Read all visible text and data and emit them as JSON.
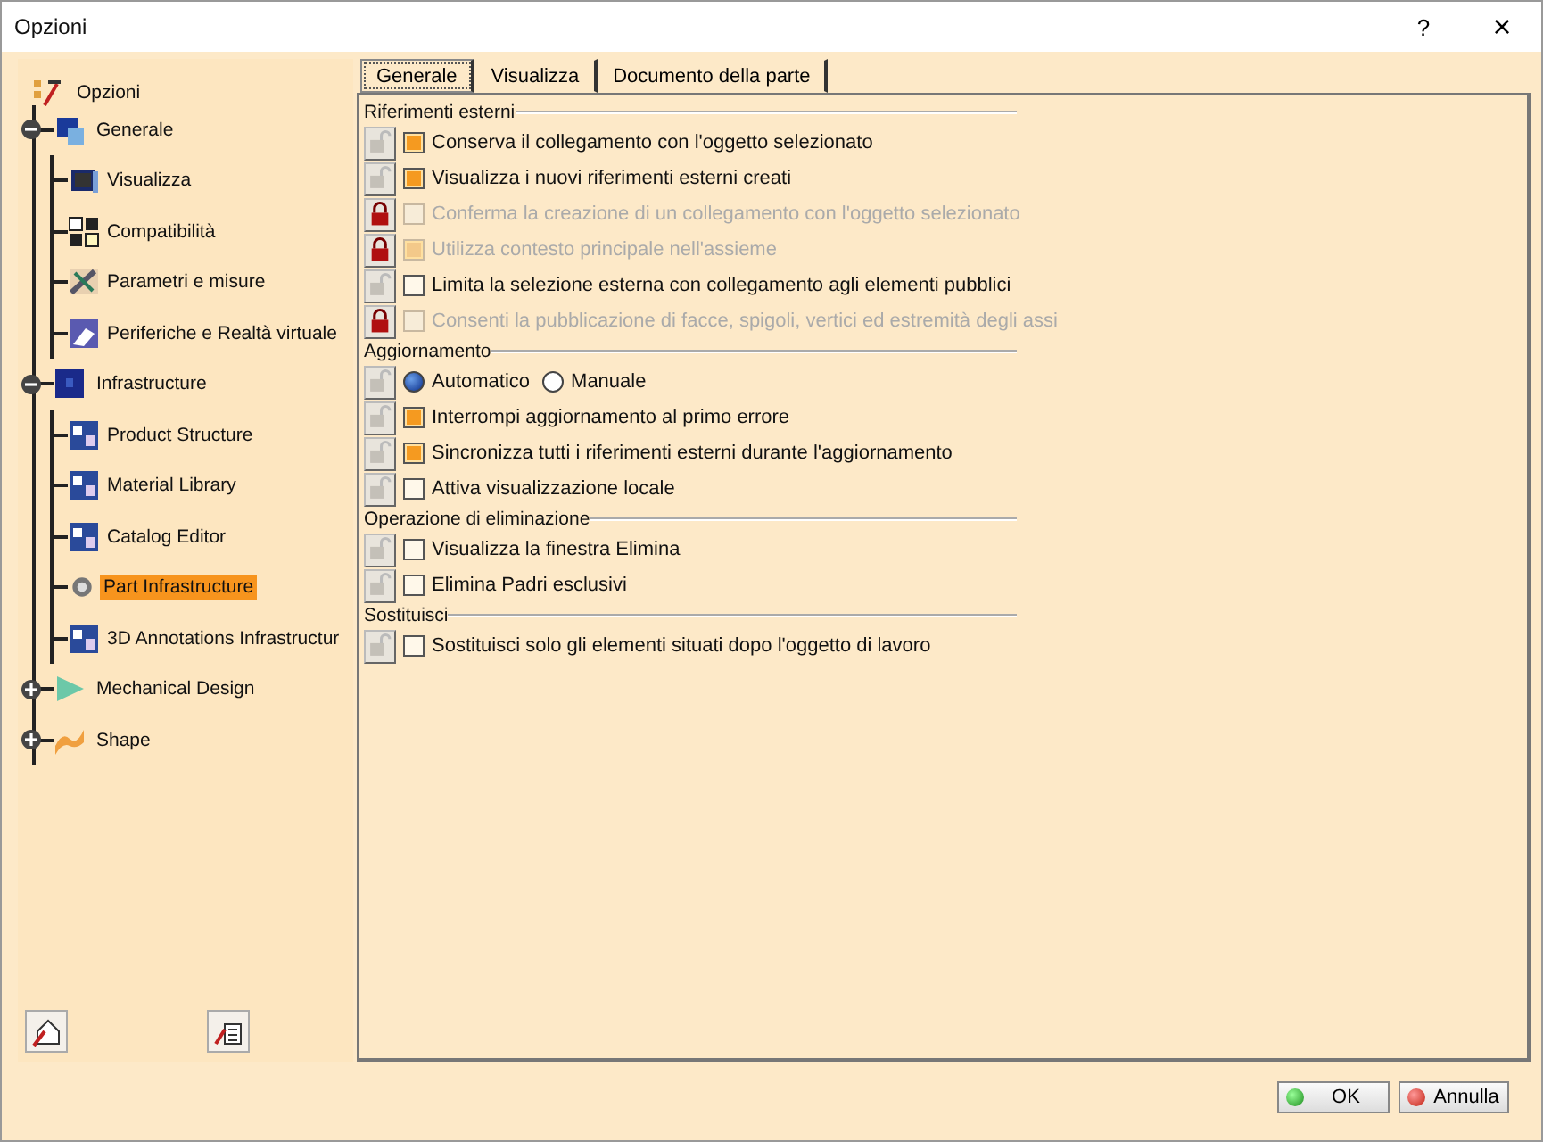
{
  "window": {
    "title": "Opzioni",
    "help": "?",
    "close": "×"
  },
  "tree": {
    "label": "Opzioni",
    "children": [
      {
        "label": "Generale",
        "expanded": true,
        "selected": false,
        "children": [
          {
            "label": "Visualizza",
            "selected": false
          },
          {
            "label": "Compatibilità",
            "selected": false
          },
          {
            "label": "Parametri e misure",
            "selected": false
          },
          {
            "label": "Periferiche e Realtà virtuale",
            "selected": false
          }
        ]
      },
      {
        "label": "Infrastructure",
        "expanded": true,
        "selected": false,
        "children": [
          {
            "label": "Product Structure",
            "selected": false
          },
          {
            "label": "Material Library",
            "selected": false
          },
          {
            "label": "Catalog Editor",
            "selected": false
          },
          {
            "label": "Part Infrastructure",
            "selected": true
          },
          {
            "label": "3D Annotations Infrastructur",
            "selected": false
          }
        ]
      },
      {
        "label": "Mechanical Design",
        "expanded": false,
        "selected": false
      },
      {
        "label": "Shape",
        "expanded": false,
        "selected": false
      }
    ]
  },
  "tabs": [
    {
      "label": "Generale",
      "selected": true
    },
    {
      "label": "Visualizza",
      "selected": false
    },
    {
      "label": "Documento della parte",
      "selected": false
    }
  ],
  "sections": [
    {
      "title": "Riferimenti esterni",
      "options": [
        {
          "kind": "checkbox",
          "label": "Conserva il collegamento con l'oggetto selezionato",
          "checked": true,
          "disabled": false,
          "locked": false
        },
        {
          "kind": "checkbox",
          "label": "Visualizza i nuovi riferimenti esterni creati",
          "checked": true,
          "disabled": false,
          "locked": false
        },
        {
          "kind": "checkbox",
          "label": "Conferma la creazione di un collegamento con l'oggetto selezionato",
          "checked": false,
          "disabled": true,
          "locked": true
        },
        {
          "kind": "checkbox",
          "label": "Utilizza contesto principale nell'assieme",
          "checked": true,
          "disabled": true,
          "locked": true
        },
        {
          "kind": "checkbox",
          "label": "Limita la selezione esterna con collegamento agli elementi pubblici",
          "checked": false,
          "disabled": false,
          "locked": false
        },
        {
          "kind": "checkbox",
          "label": "Consenti la pubblicazione di facce, spigoli, vertici ed estremità degli assi",
          "checked": false,
          "disabled": true,
          "locked": true
        }
      ]
    },
    {
      "title": "Aggiornamento",
      "options": [
        {
          "kind": "radio",
          "locked": false,
          "choices": [
            {
              "label": "Automatico",
              "selected": true
            },
            {
              "label": "Manuale",
              "selected": false
            }
          ]
        },
        {
          "kind": "checkbox",
          "label": "Interrompi aggiornamento al primo errore",
          "checked": true,
          "disabled": false,
          "locked": false
        },
        {
          "kind": "checkbox",
          "label": "Sincronizza tutti i riferimenti esterni durante l'aggiornamento",
          "checked": true,
          "disabled": false,
          "locked": false
        },
        {
          "kind": "checkbox",
          "label": "Attiva visualizzazione locale",
          "checked": false,
          "disabled": false,
          "locked": false
        }
      ]
    },
    {
      "title": "Operazione di eliminazione",
      "options": [
        {
          "kind": "checkbox",
          "label": "Visualizza la finestra Elimina",
          "checked": false,
          "disabled": false,
          "locked": false
        },
        {
          "kind": "checkbox",
          "label": "Elimina Padri esclusivi",
          "checked": false,
          "disabled": false,
          "locked": false
        }
      ]
    },
    {
      "title": "Sostituisci",
      "options": [
        {
          "kind": "checkbox",
          "label": "Sostituisci solo gli elementi situati dopo l'oggetto di lavoro",
          "checked": false,
          "disabled": false,
          "locked": false
        }
      ]
    }
  ],
  "buttons": [
    {
      "kind": "ok",
      "label": "OK"
    },
    {
      "kind": "cancel",
      "label": "Annulla"
    }
  ]
}
